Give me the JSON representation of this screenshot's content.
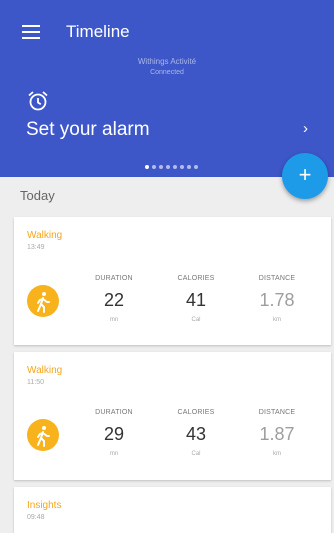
{
  "header": {
    "title": "Timeline",
    "device_name": "Withings Activité",
    "device_status": "Connected",
    "alarm_text": "Set your alarm",
    "carousel_page": 1,
    "carousel_count": 8,
    "background_color": "#3d57c9",
    "icons": {
      "menu": "hamburger-icon",
      "alarm": "alarm-clock-icon",
      "next": "chevron-right-icon"
    }
  },
  "fab": {
    "symbol": "+",
    "color": "#1e9be8",
    "icon": "plus-icon"
  },
  "section": {
    "title": "Today"
  },
  "cards": [
    {
      "type": "Walking",
      "time": "13:49",
      "icon": "walking-icon",
      "metrics": [
        {
          "label": "DURATION",
          "value": "22",
          "unit": "mn"
        },
        {
          "label": "CALORIES",
          "value": "41",
          "unit": "Cal"
        },
        {
          "label": "DISTANCE",
          "value": "1.78",
          "unit": "km"
        }
      ]
    },
    {
      "type": "Walking",
      "time": "11:50",
      "icon": "walking-icon",
      "metrics": [
        {
          "label": "DURATION",
          "value": "29",
          "unit": "mn"
        },
        {
          "label": "CALORIES",
          "value": "43",
          "unit": "Cal"
        },
        {
          "label": "DISTANCE",
          "value": "1.87",
          "unit": "km"
        }
      ]
    },
    {
      "type": "Insights",
      "time": "09:48"
    }
  ],
  "colors": {
    "accent_orange": "#f4a61b",
    "icon_orange": "#f7b21c"
  }
}
